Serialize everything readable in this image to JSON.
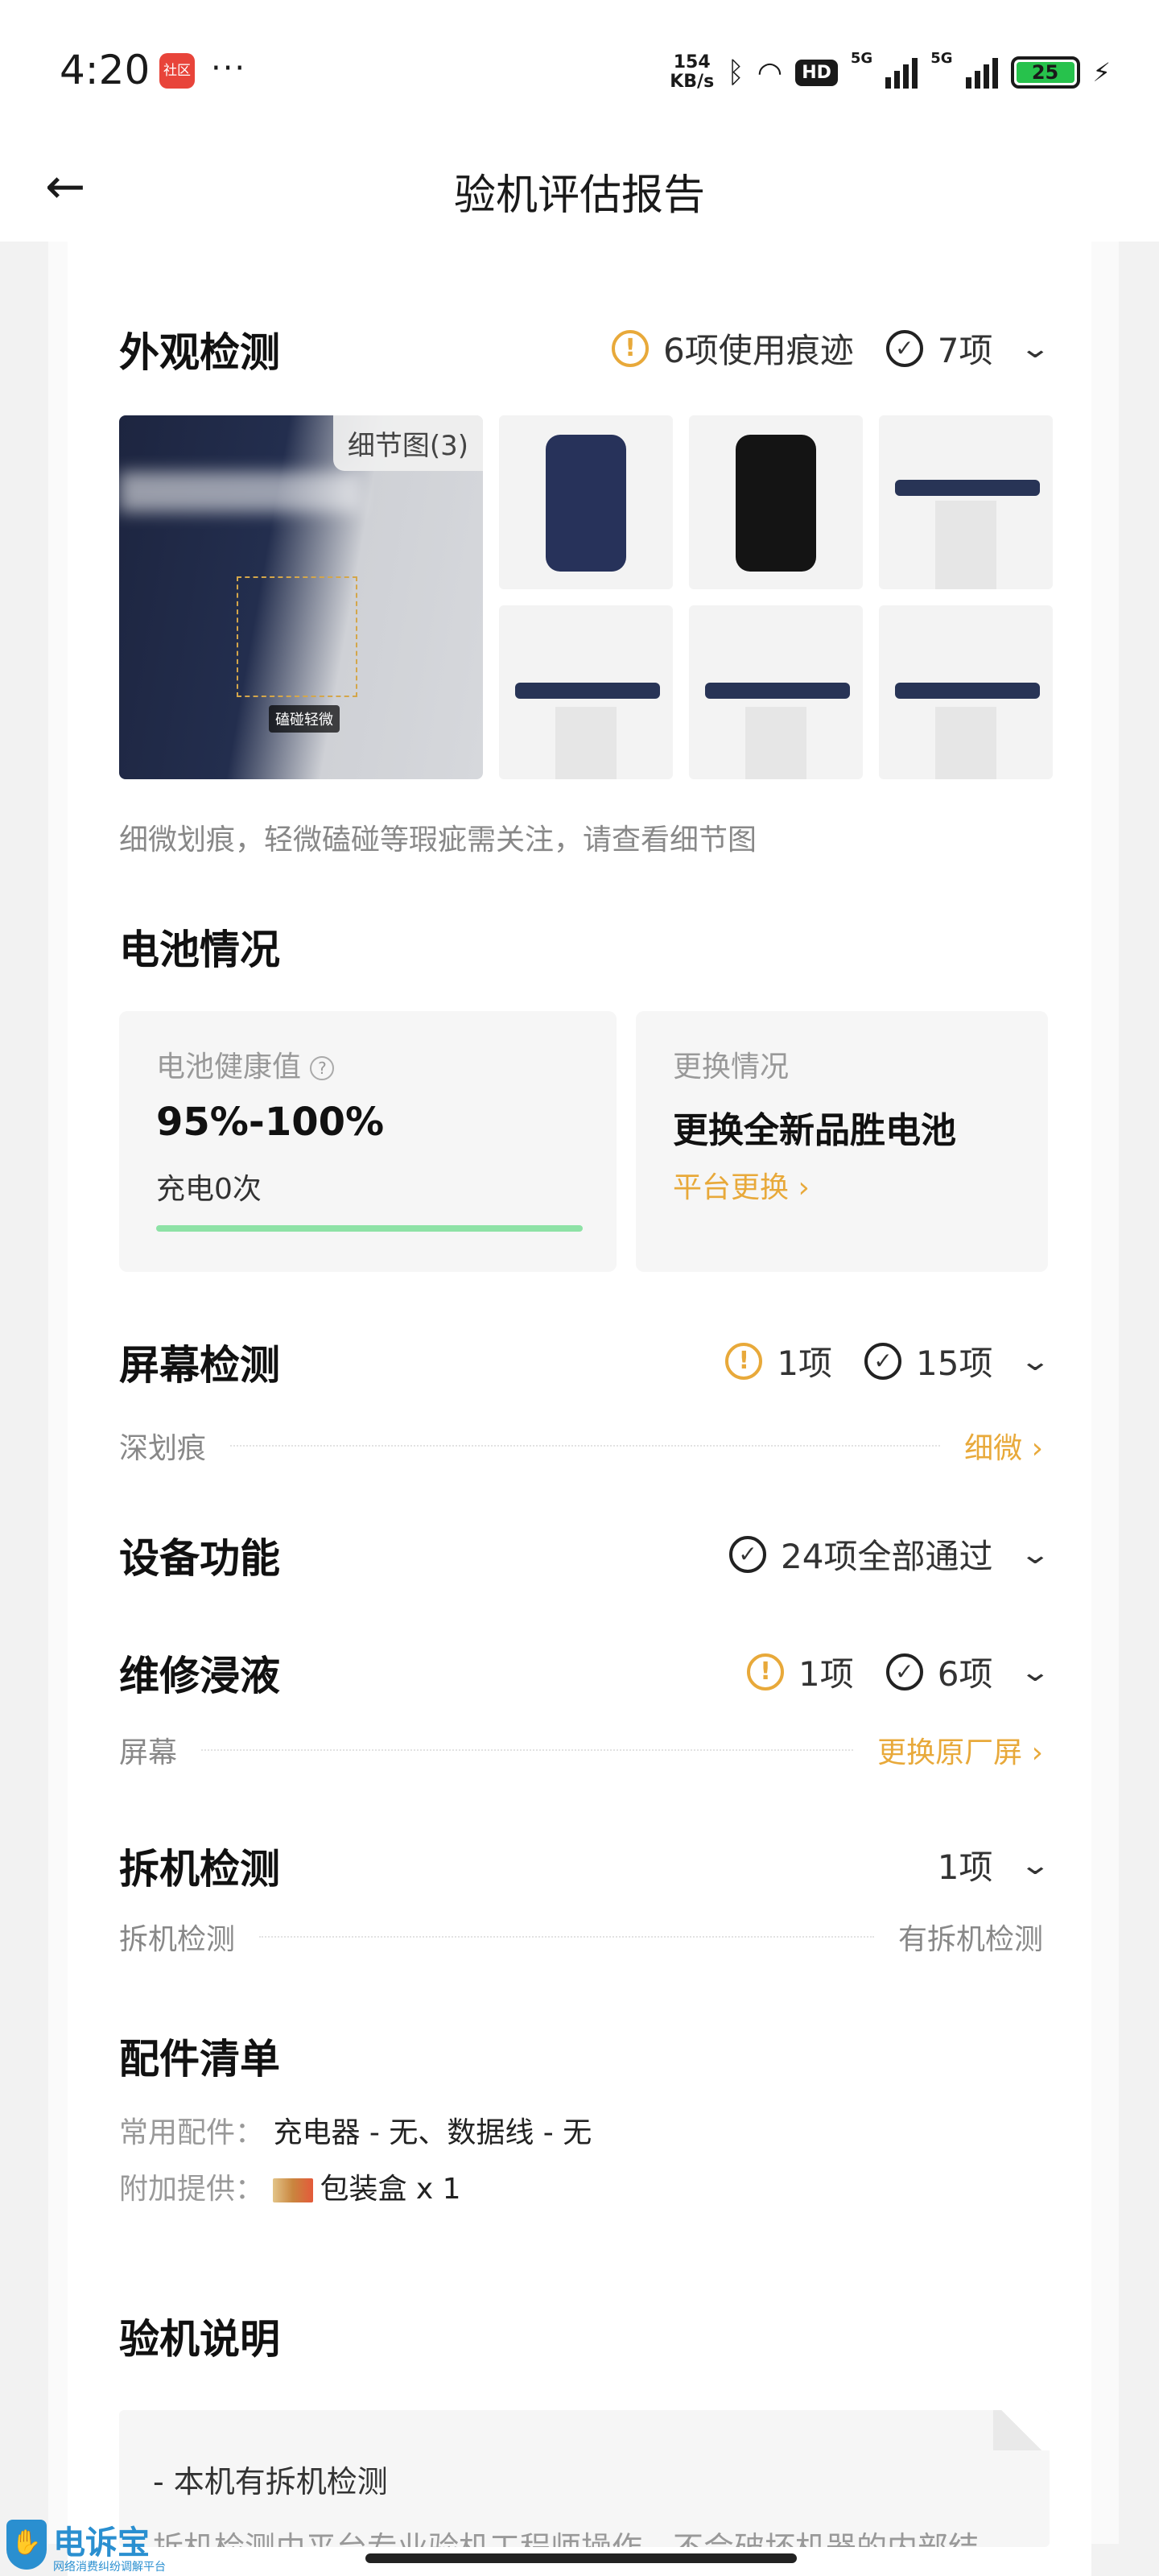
{
  "status_bar": {
    "time": "4:20",
    "app_badge": "社区",
    "more": "···",
    "net_speed_value": "154",
    "net_speed_unit": "KB/s",
    "hd": "HD",
    "net1": "5G",
    "net2": "5G",
    "battery": "25"
  },
  "header": {
    "title": "验机评估报告"
  },
  "appearance": {
    "title": "外观检测",
    "warn": "6项使用痕迹",
    "pass": "7项",
    "photo_label": "细节图(3)",
    "photo_tag": "磕碰轻微",
    "note": "细微划痕，轻微磕碰等瑕疵需关注，请查看细节图"
  },
  "battery": {
    "title": "电池情况",
    "health_label": "电池健康值",
    "health_value": "95%-100%",
    "charge_count": "充电0次",
    "health_fraction": 1.0,
    "replace_label": "更换情况",
    "replace_value": "更换全新品胜电池",
    "replace_link": "平台更换"
  },
  "screen": {
    "title": "屏幕检测",
    "warn": "1项",
    "pass": "15项",
    "row_label": "深划痕",
    "row_value": "细微"
  },
  "function": {
    "title": "设备功能",
    "pass": "24项全部通过"
  },
  "repair": {
    "title": "维修浸液",
    "warn": "1项",
    "pass": "6项",
    "row_label": "屏幕",
    "row_value": "更换原厂屏"
  },
  "disassembly": {
    "title": "拆机检测",
    "count": "1项",
    "row_label": "拆机检测",
    "row_value": "有拆机检测"
  },
  "accessories": {
    "title": "配件清单",
    "common_label": "常用配件：",
    "common_value": "充电器 - 无、数据线 - 无",
    "extra_label": "附加提供：",
    "extra_value": "包装盒 x 1"
  },
  "inspection": {
    "title": "验机说明",
    "line1": "-  本机有拆机检测",
    "line2": "拆机检测由平台专业验机工程师操作，不会破坏机器的内部结"
  },
  "watermark": {
    "title": "电诉宝",
    "subtitle": "网络消费纠纷调解平台"
  }
}
